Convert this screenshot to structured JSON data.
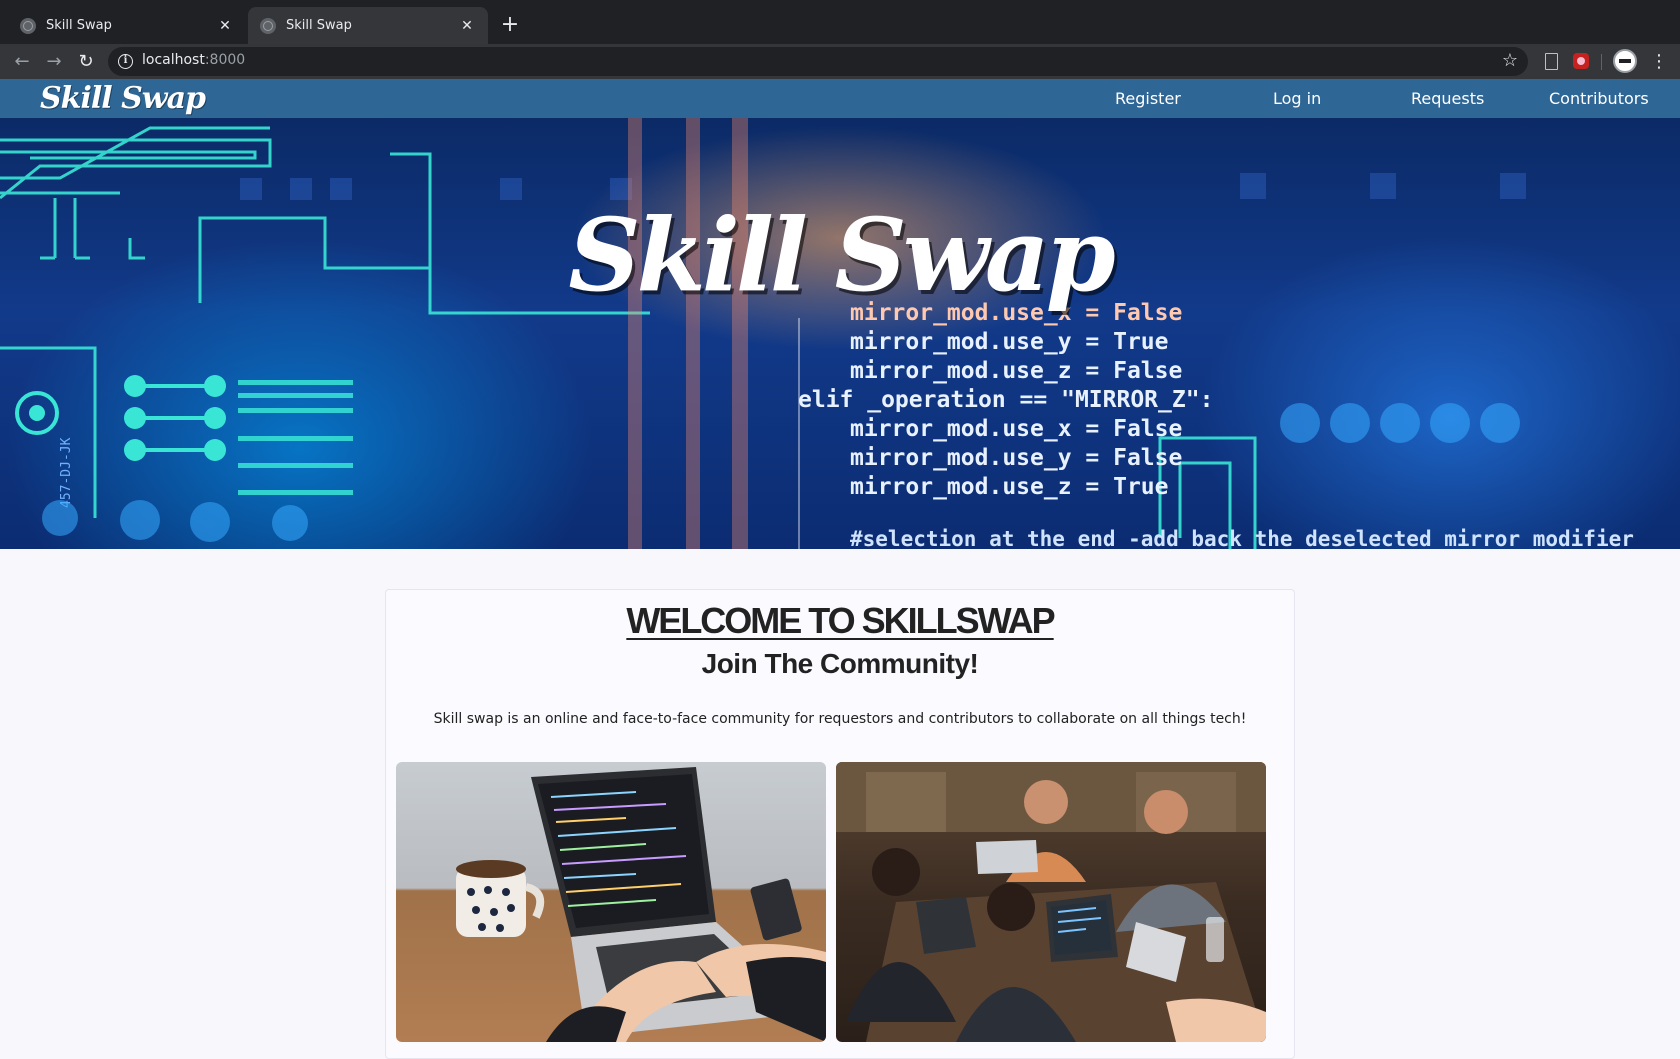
{
  "browser": {
    "tabs": [
      {
        "title": "Skill Swap",
        "active": false
      },
      {
        "title": "Skill Swap",
        "active": true
      }
    ],
    "url_host": "localhost",
    "url_port": ":8000"
  },
  "navbar": {
    "brand": "Skill Swap",
    "links": [
      "Register",
      "Log in",
      "Requests",
      "Contributors"
    ],
    "color": "#2e6696"
  },
  "hero": {
    "title": "Skill Swap",
    "code_lines": [
      "mirror_mod.use_x = False",
      "mirror_mod.use_y = True",
      "mirror_mod.use_z = False",
      "elif _operation == \"MIRROR_Z\":",
      "mirror_mod.use_x = False",
      "mirror_mod.use_y = False",
      "mirror_mod.use_z = True",
      "#selection at the end -add back the deselected mirror modifier"
    ],
    "chip_label": "457-DJ-JK"
  },
  "welcome": {
    "heading": "WELCOME TO SKILLSWAP",
    "subheading": "Join The Community!",
    "description": "Skill swap is an online and face-to-face community for requestors and contributors to collaborate on all things tech!"
  },
  "icons": {
    "back": "arrow-left-icon",
    "forward": "arrow-right-icon",
    "reload": "reload-icon",
    "info": "info-icon",
    "bookmark": "star-icon",
    "menu": "kebab-menu-icon"
  }
}
